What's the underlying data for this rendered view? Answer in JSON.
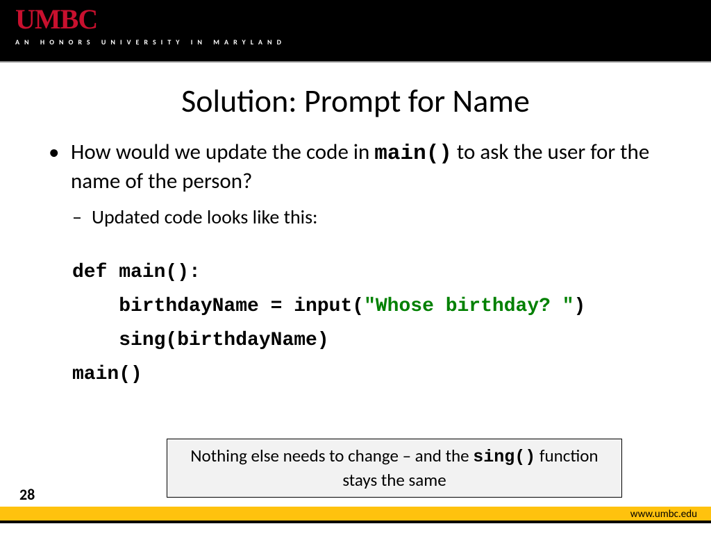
{
  "header": {
    "logo": "UMBC",
    "tagline": "AN HONORS UNIVERSITY IN MARYLAND"
  },
  "title": "Solution: Prompt for Name",
  "bullets": {
    "main_pre": "How would we update the code in ",
    "main_code": "main()",
    "main_post": " to ask the user for the name of the person?",
    "sub": "Updated code looks like this:"
  },
  "code": {
    "line1": "def main():",
    "line2a": "    birthdayName = input(",
    "line2b": "\"Whose birthday? \"",
    "line2c": ")",
    "line3": "    sing(birthdayName)",
    "line4": "main()"
  },
  "note": {
    "part1": "Nothing else needs to change – and the ",
    "part2": "sing()",
    "part3": " function stays the same"
  },
  "footer": {
    "page": "28",
    "url": "www.umbc.edu"
  }
}
